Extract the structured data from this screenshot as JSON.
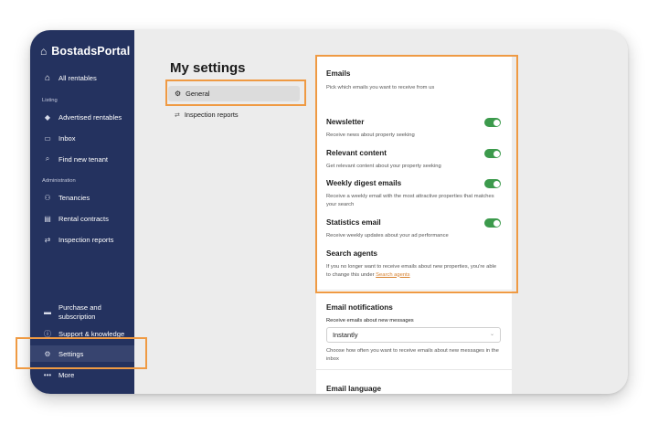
{
  "app": {
    "brand": "BostadsPortal",
    "brand_icon": "house-icon"
  },
  "sidebar": {
    "top_item": "All rentables",
    "section_listing": "Listing",
    "listing_items": [
      "Advertised rentables",
      "Inbox",
      "Find new tenant"
    ],
    "section_admin": "Administration",
    "admin_items": [
      "Tenancies",
      "Rental contracts",
      "Inspection reports"
    ],
    "bottom_items": [
      "Purchase and subscription",
      "Support & knowledge",
      "Settings",
      "More"
    ],
    "purchase_line1": "Purchase and",
    "purchase_line2": "subscription"
  },
  "page": {
    "title": "My settings"
  },
  "settings_menu": {
    "general": "General",
    "inspection": "Inspection reports"
  },
  "emails": {
    "heading": "Emails",
    "sub": "Pick which emails you want to receive from us",
    "items": [
      {
        "title": "Newsletter",
        "desc": "Receive news about property seeking",
        "enabled": true
      },
      {
        "title": "Relevant content",
        "desc": "Get relevant content about your property seeking",
        "enabled": true
      },
      {
        "title": "Weekly digest emails",
        "desc": "Receive a weekly email with the most attractive properties that matches your search",
        "enabled": true
      },
      {
        "title": "Statistics email",
        "desc": "Receive weekly updates about your ad performance",
        "enabled": true
      }
    ],
    "agents_title": "Search agents",
    "agents_desc": "If you no longer want to receive emails about new properties, you're able to change this under",
    "agents_link": "Search agents"
  },
  "notifications": {
    "heading": "Email notifications",
    "label": "Receive emails about new messages",
    "value": "Instantly",
    "help": "Choose how often you want to receive emails about new messages in the inbox"
  },
  "language": {
    "heading": "Email language"
  },
  "colors": {
    "sidebar": "#24325f",
    "accent": "#ef9a43",
    "toggle": "#3c9a4c",
    "link": "#d7812e"
  }
}
